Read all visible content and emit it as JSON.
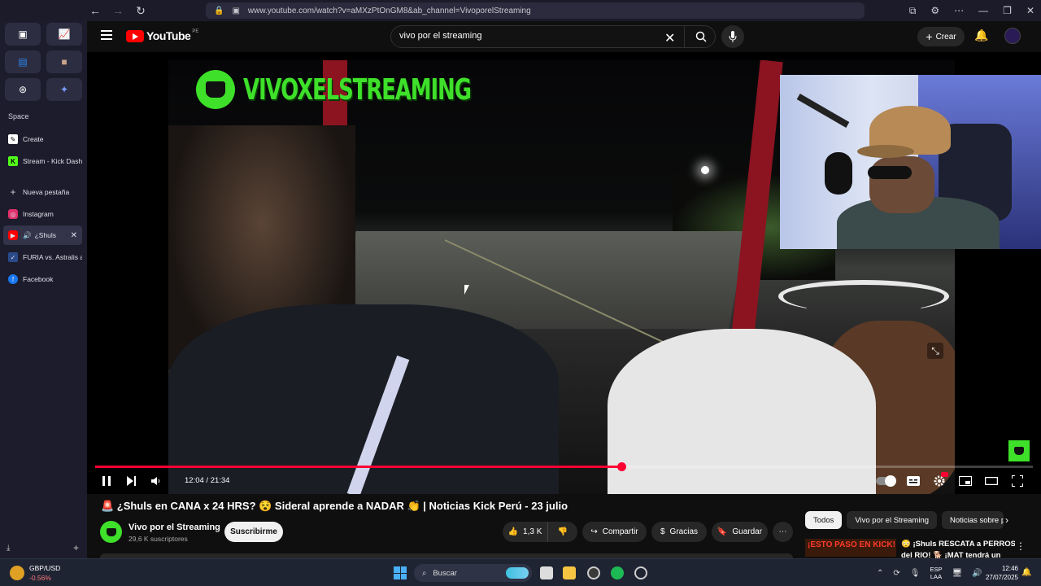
{
  "browser": {
    "url": "www.youtube.com/watch?v=aMXzPtOnGM8&ab_channel=VivoporelStreaming"
  },
  "sidebar": {
    "space_label": "Space",
    "items": [
      {
        "label": "Create",
        "icon": "create-icon",
        "color": "#ffffff"
      },
      {
        "label": "Stream - Kick Dashb",
        "icon": "kick-icon",
        "color": "#53fc18"
      },
      {
        "label": "Nueva pestaña",
        "icon": "plus-icon",
        "color": "#cccccc"
      },
      {
        "label": "Instagram",
        "icon": "instagram-icon",
        "color": "#e1306c"
      },
      {
        "label": "¿Shuls",
        "icon": "youtube-icon",
        "color": "#ff0000"
      },
      {
        "label": "FURIA vs. Astralis a",
        "icon": "hltv-icon",
        "color": "#2a4a8a"
      },
      {
        "label": "Facebook",
        "icon": "facebook-icon",
        "color": "#1877f2"
      }
    ]
  },
  "youtube": {
    "logo_text": "YouTube",
    "country": "PE",
    "search_value": "vivo por el streaming",
    "create_label": "Crear",
    "brand_color": "#ff0000"
  },
  "video": {
    "overlay_text": "VIVOXELSTREAMING",
    "time": "12:04 / 21:34",
    "progress": 0.561,
    "accent_color": "#3ee02a",
    "title": "🚨 ¿Shuls en CANA x 24 HRS? 😵 Sideral aprende a NADAR 👏 | Noticias Kick Perú - 23 julio"
  },
  "channel": {
    "name": "Vivo por el Streaming",
    "subscribers": "29,6 K suscriptores",
    "subscribe_label": "Suscribirme"
  },
  "actions": {
    "likes": "1,3 K",
    "share": "Compartir",
    "thanks": "Gracias",
    "save": "Guardar"
  },
  "chips": [
    "Todos",
    "Vivo por el Streaming",
    "Noticias sobre p"
  ],
  "recommendation": {
    "thumb_text": "¡ESTO PASO EN KICK!",
    "title_line1": "😳 ¡Shuls RESCATA a PERROS",
    "title_line2": "del RIO! 🐕 ¡MAT tendrá un"
  },
  "taskbar": {
    "weather_pair": "GBP/USD",
    "weather_value": "-0.56%",
    "search_label": "Buscar",
    "lang_line1": "ESP",
    "lang_line2": "LAA",
    "time": "12:46",
    "date": "27/07/2025"
  }
}
